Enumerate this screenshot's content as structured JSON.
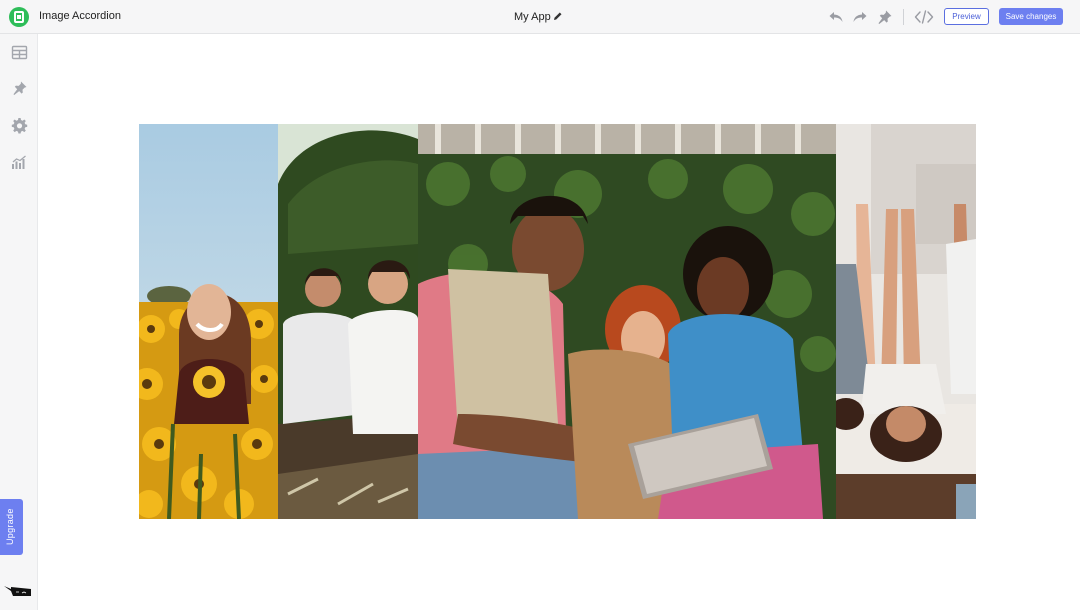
{
  "header": {
    "app_name": "Image Accordion",
    "doc_title": "My App",
    "preview_label": "Preview",
    "save_label": "Save changes"
  },
  "sidebar": {
    "items": [
      "table-icon",
      "pin-icon",
      "gear-icon",
      "analytics-icon"
    ],
    "upgrade_label": "Upgrade"
  },
  "accordion": {
    "panels": [
      {
        "name": "Woman in sunflower field"
      },
      {
        "name": "Two men sitting on grass"
      },
      {
        "name": "Friends laughing with tablet"
      },
      {
        "name": "Girls lying on floor with legs up"
      }
    ]
  },
  "colors": {
    "accent": "#6d7ff0",
    "logo_green": "#2ebd59"
  }
}
